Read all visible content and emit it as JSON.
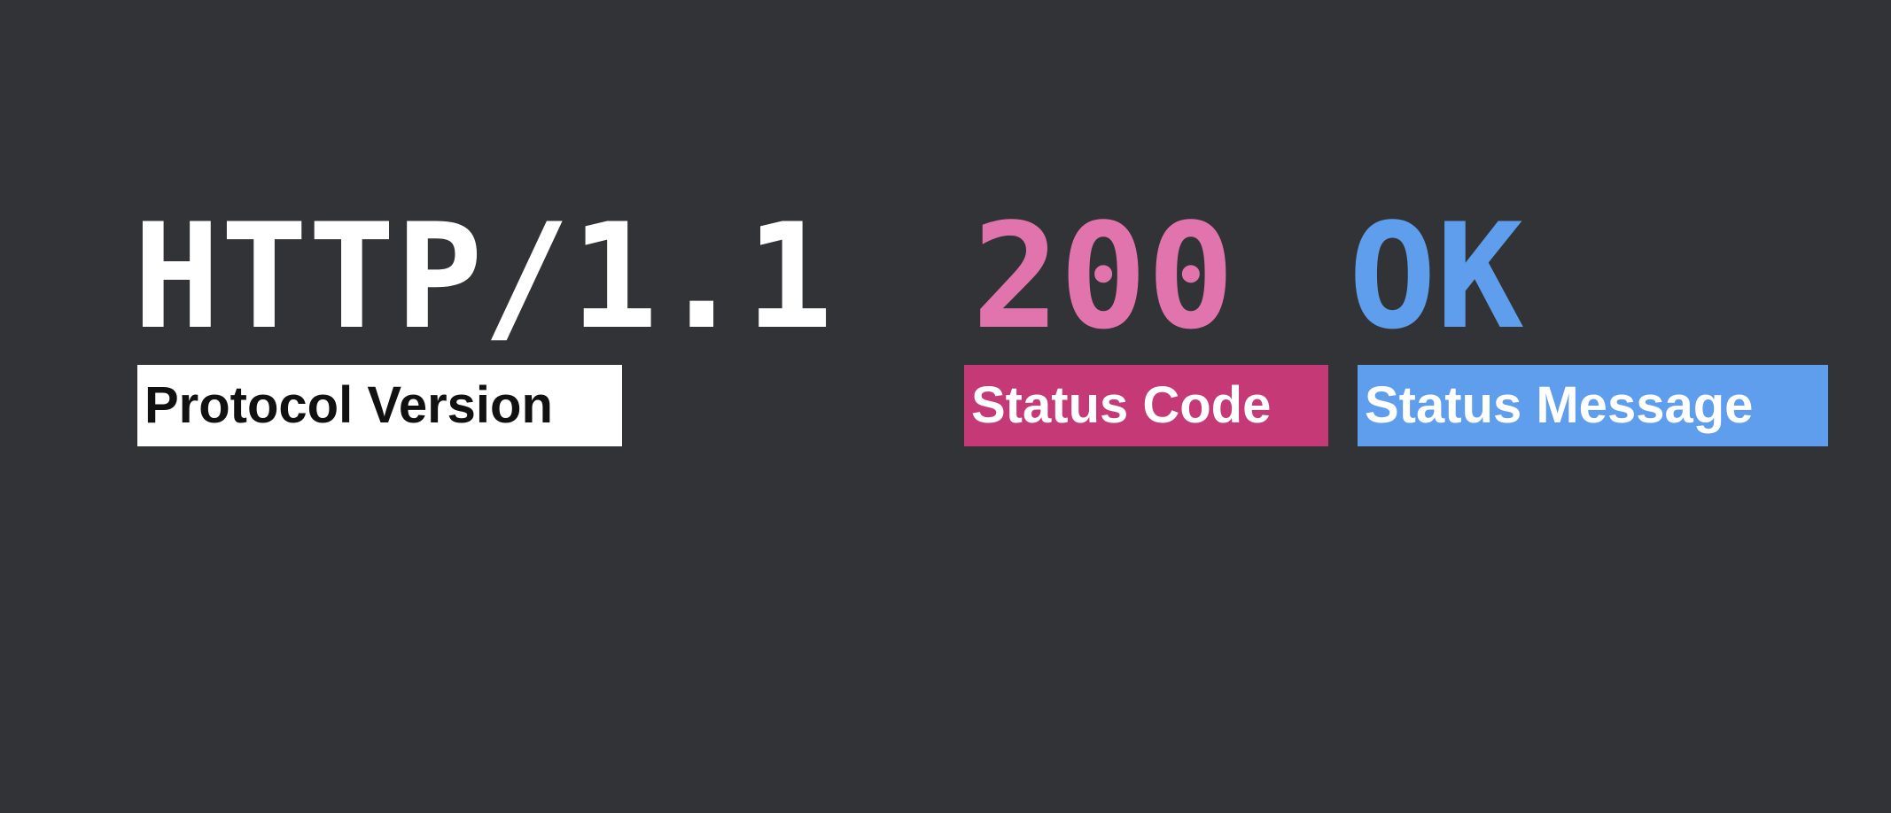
{
  "status_line": {
    "protocol_version": "HTTP/1.1",
    "status_code": "200",
    "status_message": "OK"
  },
  "labels": {
    "protocol_version": "Protocol Version",
    "status_code": "Status Code",
    "status_message": "Status Message"
  },
  "colors": {
    "background": "#323336",
    "protocol_text": "#ffffff",
    "status_code_text": "#e274ad",
    "status_message_text": "#5f9eec",
    "protocol_label_bg": "#ffffff",
    "status_code_label_bg": "#c53a76",
    "status_message_label_bg": "#5f9eec"
  }
}
